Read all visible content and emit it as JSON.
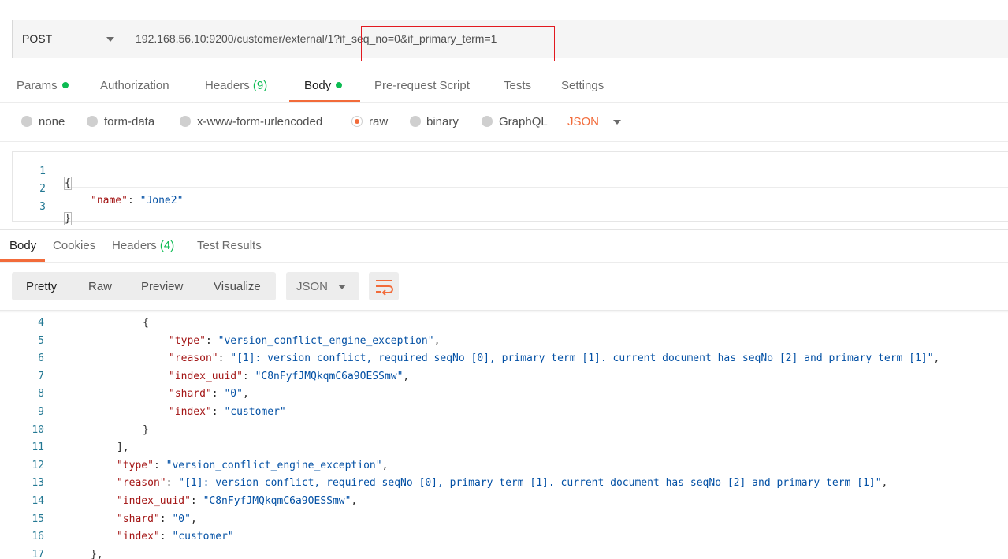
{
  "request": {
    "method": "POST",
    "url": "192.168.56.10:9200/customer/external/1?if_seq_no=0&if_primary_term=1"
  },
  "request_tabs": [
    {
      "label": "Params",
      "dot": true
    },
    {
      "label": "Authorization"
    },
    {
      "label": "Headers",
      "count": "(9)"
    },
    {
      "label": "Body",
      "dot": true,
      "active": true
    },
    {
      "label": "Pre-request Script"
    },
    {
      "label": "Tests"
    },
    {
      "label": "Settings"
    }
  ],
  "body_types": [
    "none",
    "form-data",
    "x-www-form-urlencoded",
    "raw",
    "binary",
    "GraphQL"
  ],
  "body_type_selected": "raw",
  "body_format": "JSON",
  "request_body": {
    "line_numbers": [
      "1",
      "2",
      "3"
    ],
    "open_brace": "{",
    "key": "\"name\"",
    "colon": ": ",
    "value": "\"Jone2\"",
    "close_brace": "}"
  },
  "response_tabs": [
    {
      "label": "Body",
      "active": true
    },
    {
      "label": "Cookies"
    },
    {
      "label": "Headers",
      "count": "(4)"
    },
    {
      "label": "Test Results"
    }
  ],
  "view_modes": [
    "Pretty",
    "Raw",
    "Preview",
    "Visualize"
  ],
  "response_format": "JSON",
  "response_lines": [
    {
      "n": "4",
      "text": "{"
    },
    {
      "n": "5",
      "key": "\"type\"",
      "value": "\"version_conflict_engine_exception\"",
      "trail": ","
    },
    {
      "n": "6",
      "key": "\"reason\"",
      "value": "\"[1]: version conflict, required seqNo [0], primary term [1]. current document has seqNo [2] and primary term [1]\"",
      "trail": ","
    },
    {
      "n": "7",
      "key": "\"index_uuid\"",
      "value": "\"C8nFyfJMQkqmC6a9OESSmw\"",
      "trail": ","
    },
    {
      "n": "8",
      "key": "\"shard\"",
      "value": "\"0\"",
      "trail": ","
    },
    {
      "n": "9",
      "key": "\"index\"",
      "value": "\"customer\"",
      "trail": ""
    },
    {
      "n": "10",
      "text": "}"
    },
    {
      "n": "11",
      "text": "],"
    },
    {
      "n": "12",
      "key": "\"type\"",
      "value": "\"version_conflict_engine_exception\"",
      "trail": ","
    },
    {
      "n": "13",
      "key": "\"reason\"",
      "value": "\"[1]: version conflict, required seqNo [0], primary term [1]. current document has seqNo [2] and primary term [1]\"",
      "trail": ","
    },
    {
      "n": "14",
      "key": "\"index_uuid\"",
      "value": "\"C8nFyfJMQkqmC6a9OESSmw\"",
      "trail": ","
    },
    {
      "n": "15",
      "key": "\"shard\"",
      "value": "\"0\"",
      "trail": ","
    },
    {
      "n": "16",
      "key": "\"index\"",
      "value": "\"customer\"",
      "trail": ""
    },
    {
      "n": "17",
      "text": "},"
    }
  ],
  "colors": {
    "accent": "#f26b3a",
    "green": "#0cbb52",
    "highlight_box": "#e2191f"
  }
}
